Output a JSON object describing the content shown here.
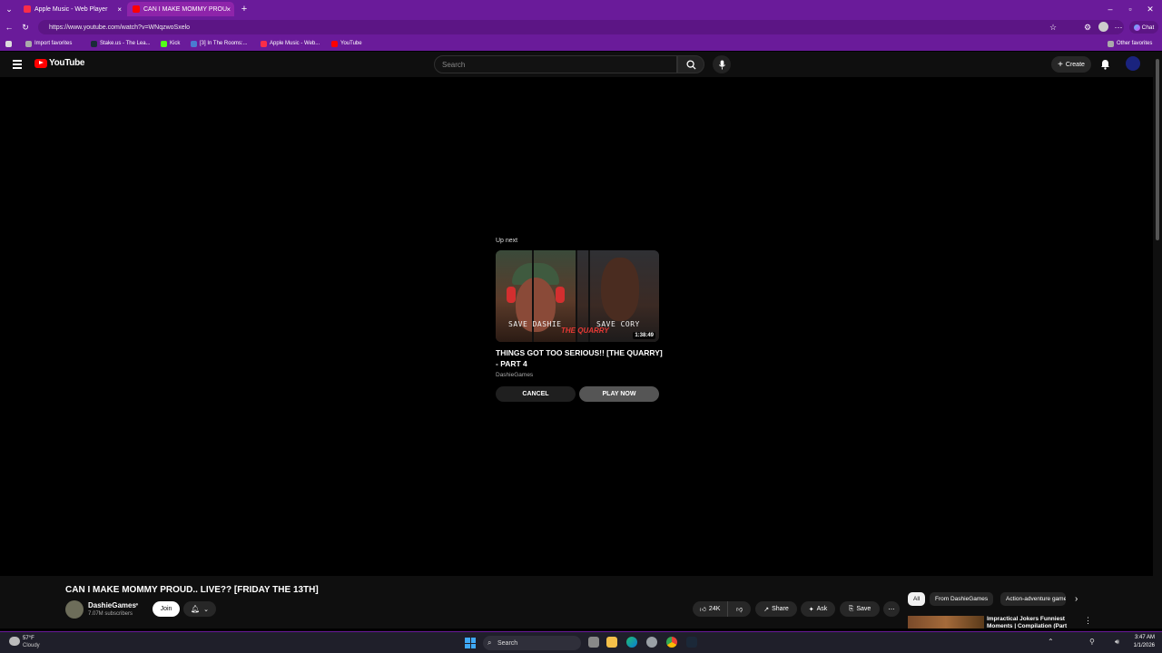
{
  "browser": {
    "tabs": [
      {
        "label": "Apple Music - Web Player",
        "active": false,
        "favicon_color": "#fa2d48"
      },
      {
        "label": "CAN I MAKE MOMMY PROUD.. LI",
        "active": true,
        "favicon_color": "#ff0000"
      }
    ],
    "url": "https://www.youtube.com/watch?v=WNqzwoSxelo",
    "chat_label": "Chat",
    "favorites": [
      {
        "label": "Import favorites",
        "color": "#aaaaaa"
      },
      {
        "label": "Stake.us - The Lea...",
        "color": "#1a2c38"
      },
      {
        "label": "Kick",
        "color": "#53fc18"
      },
      {
        "label": "[3] In The Rooms:...",
        "color": "#4a7bd0"
      },
      {
        "label": "Apple Music - Web...",
        "color": "#fa2d48"
      },
      {
        "label": "YouTube",
        "color": "#ff0000"
      }
    ],
    "other_favorites": "Other favorites"
  },
  "youtube": {
    "logo_text": "YouTube",
    "search_placeholder": "Search",
    "create_label": "Create"
  },
  "up_next": {
    "label": "Up next",
    "title": "THINGS GOT TOO SERIOUS!! [THE QUARRY] - PART 4",
    "channel": "DashieGames",
    "duration": "1:38:49",
    "thumb_caption_left": "SAVE DASHIE",
    "thumb_caption_right": "SAVE CORY",
    "thumb_logo": "THE QUARRY",
    "cancel_label": "CANCEL",
    "play_now_label": "PLAY NOW"
  },
  "video": {
    "title": "CAN I MAKE MOMMY PROUD.. LIVE?? [FRIDAY THE 13TH]",
    "channel_name": "DashieGames",
    "subscribers": "7.07M subscribers",
    "join_label": "Join",
    "like_count": "24K",
    "share_label": "Share",
    "ask_label": "Ask",
    "save_label": "Save"
  },
  "chips": [
    "All",
    "From DashieGames",
    "Action-adventure games"
  ],
  "recommendation": {
    "title": "Impractical Jokers Funniest Moments | Compilation (Part"
  },
  "taskbar": {
    "weather_temp": "57°F",
    "weather_cond": "Cloudy",
    "search_label": "Search",
    "time": "3:47 AM",
    "date": "1/1/2026"
  }
}
